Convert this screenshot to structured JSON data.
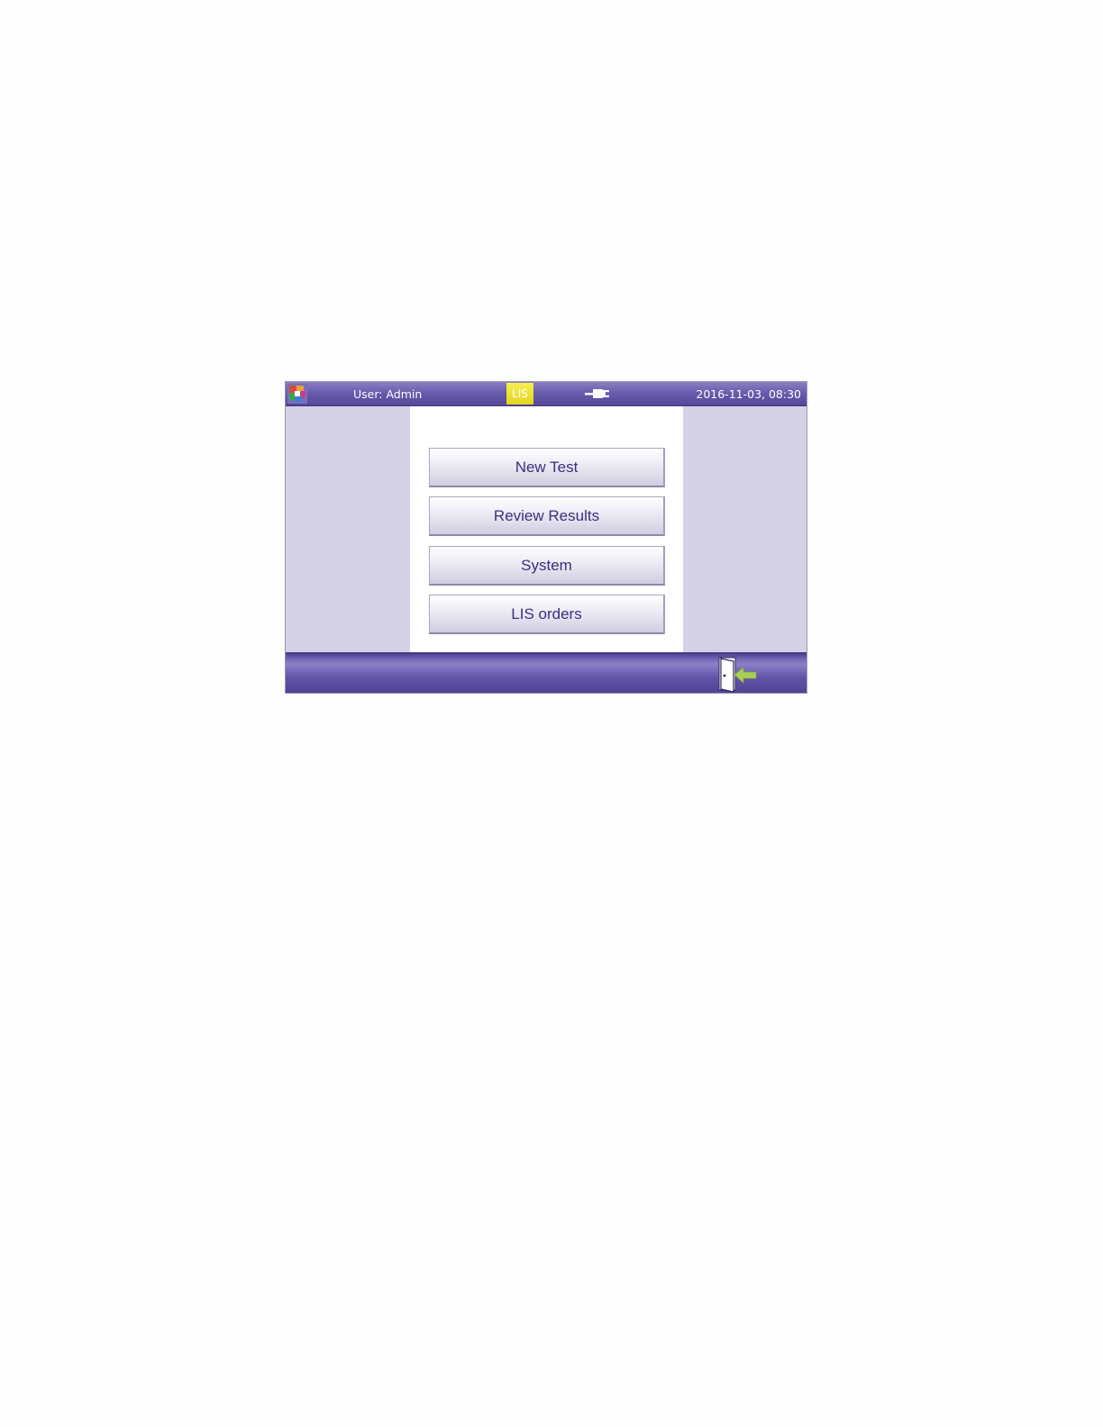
{
  "header": {
    "user_label": "User: Admin",
    "lis_badge": "LIS",
    "datetime": "2016-11-03, 08:30",
    "icons": [
      "app-logo-icon",
      "power-plug-icon"
    ]
  },
  "menu": {
    "items": [
      {
        "label": "New Test"
      },
      {
        "label": "Review Results"
      },
      {
        "label": "System"
      },
      {
        "label": "LIS orders"
      }
    ]
  },
  "footer": {
    "icons": [
      "exit-door-icon"
    ]
  },
  "colors": {
    "bar_purple": "#6a5cad",
    "side_lavender": "#d4d1e7",
    "button_text": "#3c2e80",
    "lis_yellow": "#efe237",
    "exit_arrow_green": "#a9cf55"
  }
}
